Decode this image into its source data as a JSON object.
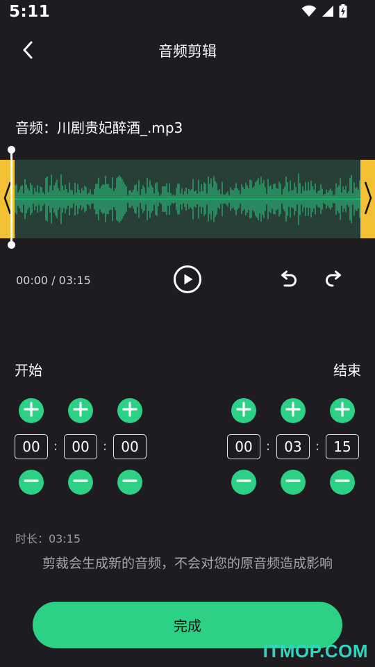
{
  "status_bar": {
    "time": "5:11",
    "icons": [
      "wifi-icon",
      "cell-signal-icon",
      "battery-charging-icon"
    ]
  },
  "header": {
    "title": "音频剪辑",
    "back_icon": "back-arrow-icon"
  },
  "file": {
    "label": "音频：川剧贵妃醉酒_.mp3"
  },
  "waveform": {
    "colors": {
      "background": "#273f37",
      "wave": "#2dd185",
      "handle": "#f2bf35"
    }
  },
  "transport": {
    "time": "00:00 / 03:15",
    "play_icon": "play-circle-icon",
    "undo_icon": "undo-icon",
    "redo_icon": "redo-icon"
  },
  "start": {
    "label": "开始",
    "hours": "00",
    "minutes": "00",
    "seconds": "00"
  },
  "end": {
    "label": "结束",
    "hours": "00",
    "minutes": "03",
    "seconds": "15"
  },
  "separator": ":",
  "duration": "时长：03:15",
  "hint": "剪裁会生成新的音频，不会对您的原音频造成影响",
  "done_label": "完成",
  "watermark": "ITMOP.COM",
  "colors": {
    "accent": "#2dd185",
    "background": "#1e1c21",
    "handle": "#f2bf35"
  }
}
